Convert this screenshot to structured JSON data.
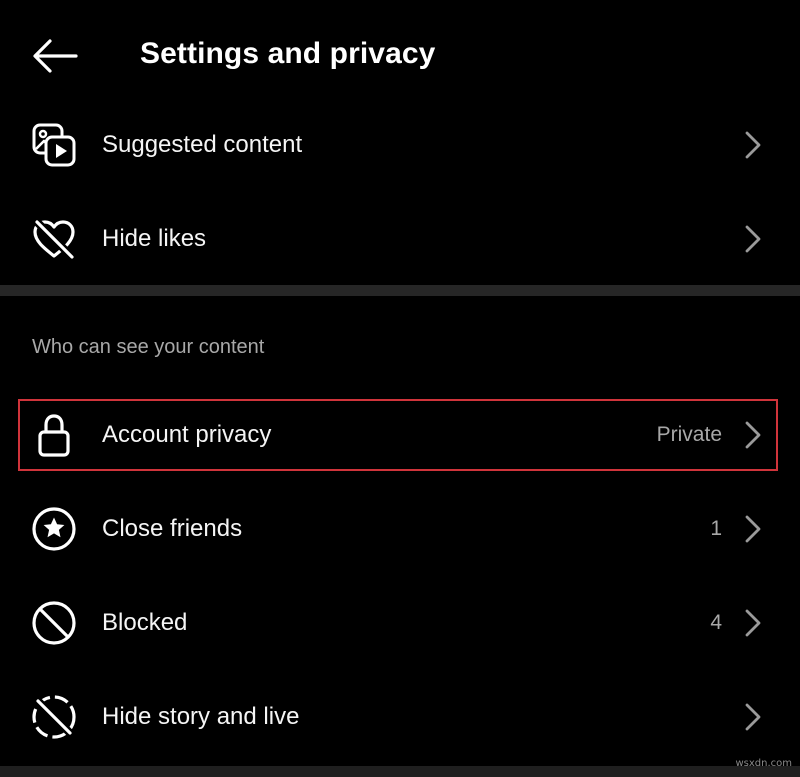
{
  "header": {
    "title": "Settings and privacy",
    "back_icon": "arrow-left-icon"
  },
  "top_items": [
    {
      "label": "Suggested content",
      "icon": "suggested-content-icon"
    },
    {
      "label": "Hide likes",
      "icon": "heart-slash-icon"
    }
  ],
  "section": {
    "title": "Who can see your content",
    "items": [
      {
        "label": "Account privacy",
        "value": "Private",
        "icon": "lock-icon",
        "highlighted": true
      },
      {
        "label": "Close friends",
        "value": "1",
        "icon": "star-circle-icon"
      },
      {
        "label": "Blocked",
        "value": "4",
        "icon": "block-icon"
      },
      {
        "label": "Hide story and live",
        "icon": "story-slash-icon"
      }
    ]
  },
  "colors": {
    "background": "#000000",
    "text": "#f5f5f5",
    "muted_text": "#a8a8a8",
    "divider": "#262626",
    "highlight": "#d0343b"
  },
  "watermark": "wsxdn.com"
}
